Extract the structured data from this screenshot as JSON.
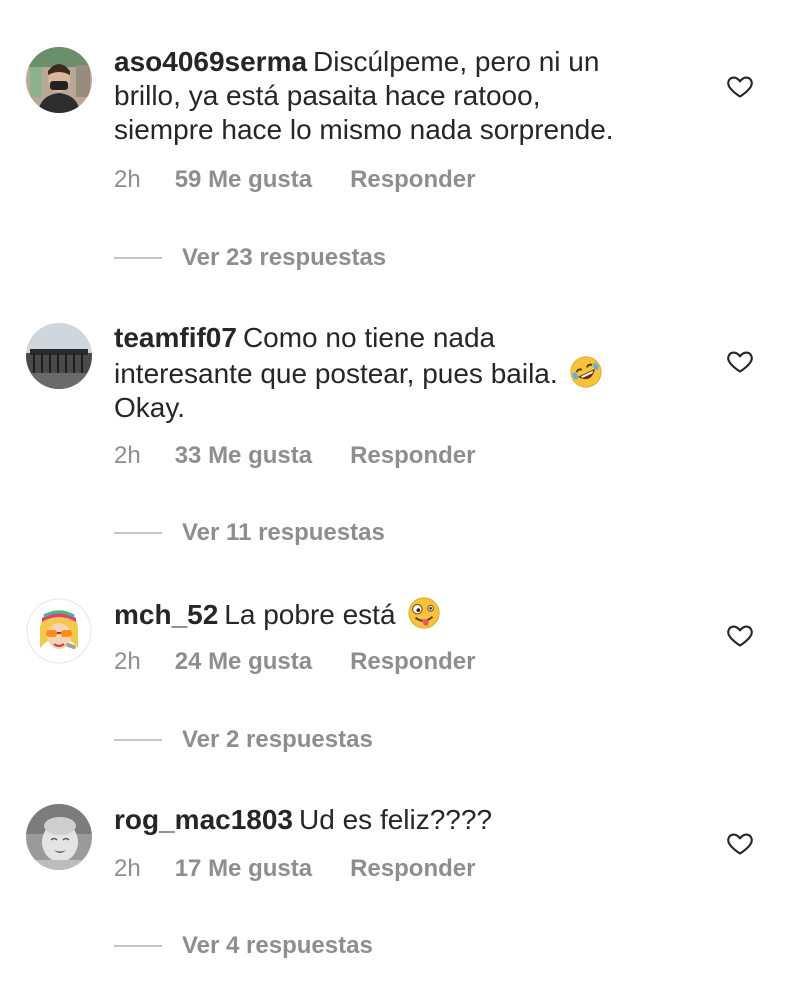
{
  "comments": [
    {
      "username": "aso4069serma",
      "text_lines": [
        "Discúlpeme, pero ni un",
        "brillo, ya está pasaita hace ratooo,",
        "siempre hace lo mismo nada sorprende."
      ],
      "time": "2h",
      "likes": "59 Me gusta",
      "reply": "Responder",
      "view_replies": "Ver 23 respuestas",
      "avatar_icon": "avatar-photo-icon"
    },
    {
      "username": "teamfif07",
      "text_lines": [
        "Como no tiene nada",
        "interesante que postear, pues baila.",
        "Okay."
      ],
      "emoji": "rolling-laughing-emoji",
      "time": "2h",
      "likes": "33 Me gusta",
      "reply": "Responder",
      "view_replies": "Ver 11 respuestas",
      "avatar_icon": "avatar-photo-icon"
    },
    {
      "username": "mch_52",
      "text_lines": [
        "La pobre está"
      ],
      "emoji": "zany-face-emoji",
      "time": "2h",
      "likes": "24 Me gusta",
      "reply": "Responder",
      "view_replies": "Ver 2 respuestas",
      "avatar_icon": "avatar-cartoon-icon"
    },
    {
      "username": "rog_mac1803",
      "text_lines": [
        "Ud es feliz????"
      ],
      "time": "2h",
      "likes": "17 Me gusta",
      "reply": "Responder",
      "view_replies": "Ver 4 respuestas",
      "avatar_icon": "avatar-baby-photo-icon"
    }
  ],
  "colors": {
    "text": "#262626",
    "meta": "#8e8e8e",
    "divider": "#c7c7c7",
    "heart_outline": "#262626"
  },
  "icons": {
    "like": "heart-outline-icon"
  }
}
